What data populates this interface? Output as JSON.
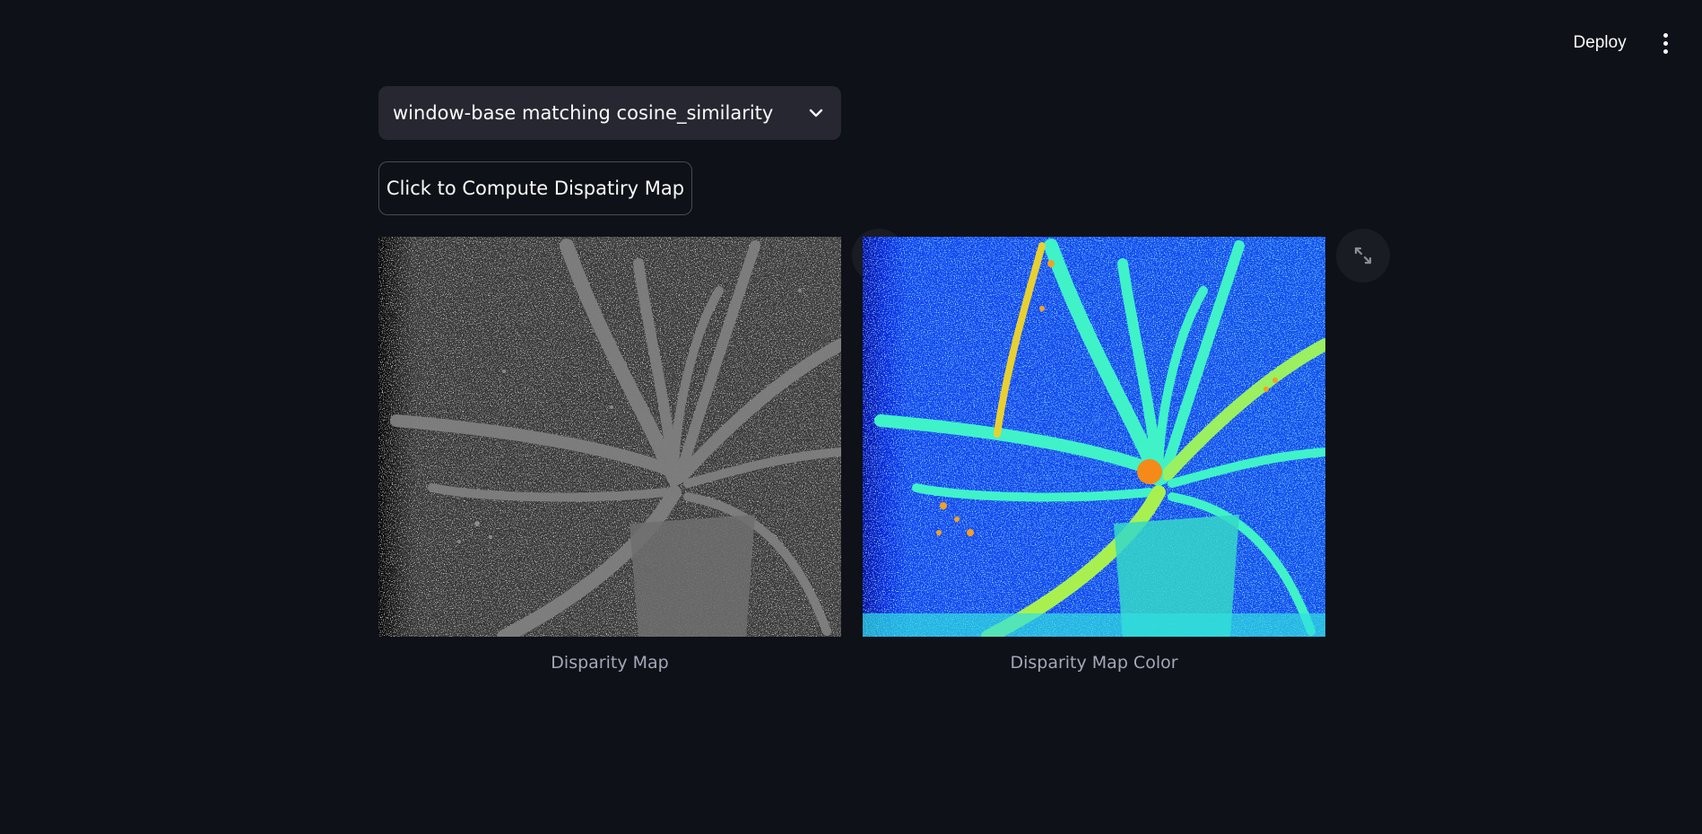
{
  "header": {
    "deploy_label": "Deploy",
    "menu_icon": "more-vertical-icon"
  },
  "method_select": {
    "selected": "window-base matching cosine_similarity"
  },
  "compute_button": {
    "label": "Click to Compute Dispatiry Map"
  },
  "images": [
    {
      "caption": "Disparity Map",
      "style": "grayscale"
    },
    {
      "caption": "Disparity Map Color",
      "style": "jet-colormap"
    }
  ],
  "colors": {
    "background": "#0e1117",
    "select_bg": "#262730",
    "text": "#fafafa",
    "caption": "#a3a8b8",
    "gray_bg": "#3c3c3c",
    "gray_plant": "#8a8a8a",
    "jet_bg": "#1546f0",
    "jet_plant": "#3ff2c8",
    "jet_hot": "#f5a020"
  }
}
